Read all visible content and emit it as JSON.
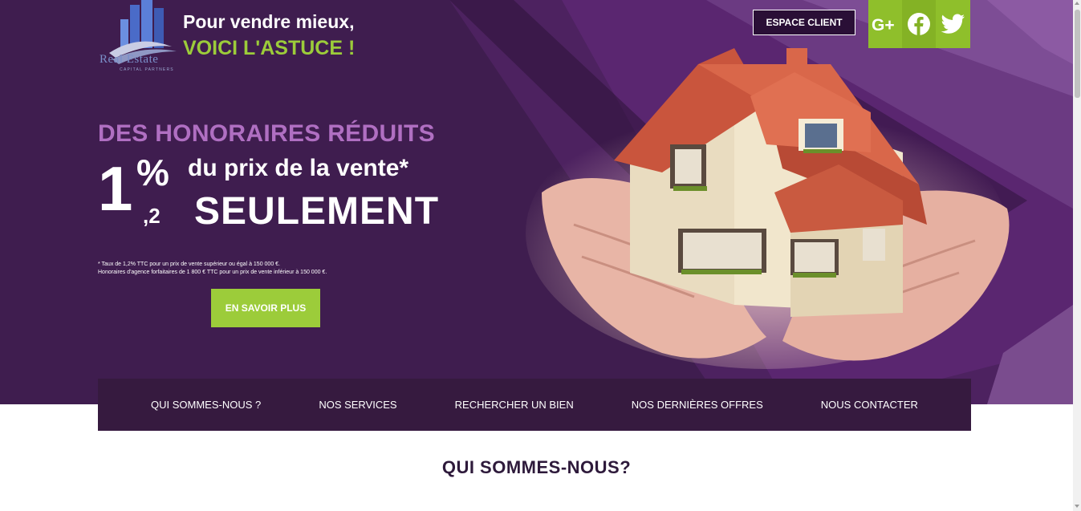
{
  "header": {
    "logo_text": "Real Estate",
    "logo_subtext": "CAPITAL PARTNERS",
    "tagline_line1": "Pour vendre mieux,",
    "tagline_line2": "VOICI L'ASTUCE !",
    "espace_client": "ESPACE CLIENT",
    "social": [
      {
        "name": "google-plus-icon",
        "glyph": "G+"
      },
      {
        "name": "facebook-icon",
        "glyph": "f"
      },
      {
        "name": "twitter-icon",
        "glyph": "twitter"
      }
    ]
  },
  "hero": {
    "heading": "DES HONORAIRES RÉDUITS",
    "rate_whole": "1",
    "rate_percent": "%",
    "rate_decimal": ",2",
    "price_line": "du prix de la vente*",
    "seulement": "SEULEMENT",
    "note_line1": "* Taux de 1,2% TTC pour un prix de vente supérieur ou égal à 150 000 €.",
    "note_line2": "Honoraires d'agence forfaitaires de 1 800 € TTC pour un prix de vente inférieur à 150 000 €.",
    "cta": "EN SAVOIR PLUS"
  },
  "nav": {
    "items": [
      "QUI SOMMES-NOUS ?",
      "NOS SERVICES",
      "RECHERCHER UN BIEN",
      "NOS DERNIÈRES OFFRES",
      "NOUS CONTACTER"
    ]
  },
  "about": {
    "title": "QUI SOMMES-NOUS?"
  },
  "colors": {
    "hero_bg": "#3f1d4f",
    "accent_green": "#9ccc3a",
    "accent_purple": "#b06fc2",
    "nav_bg": "#361a3f"
  }
}
